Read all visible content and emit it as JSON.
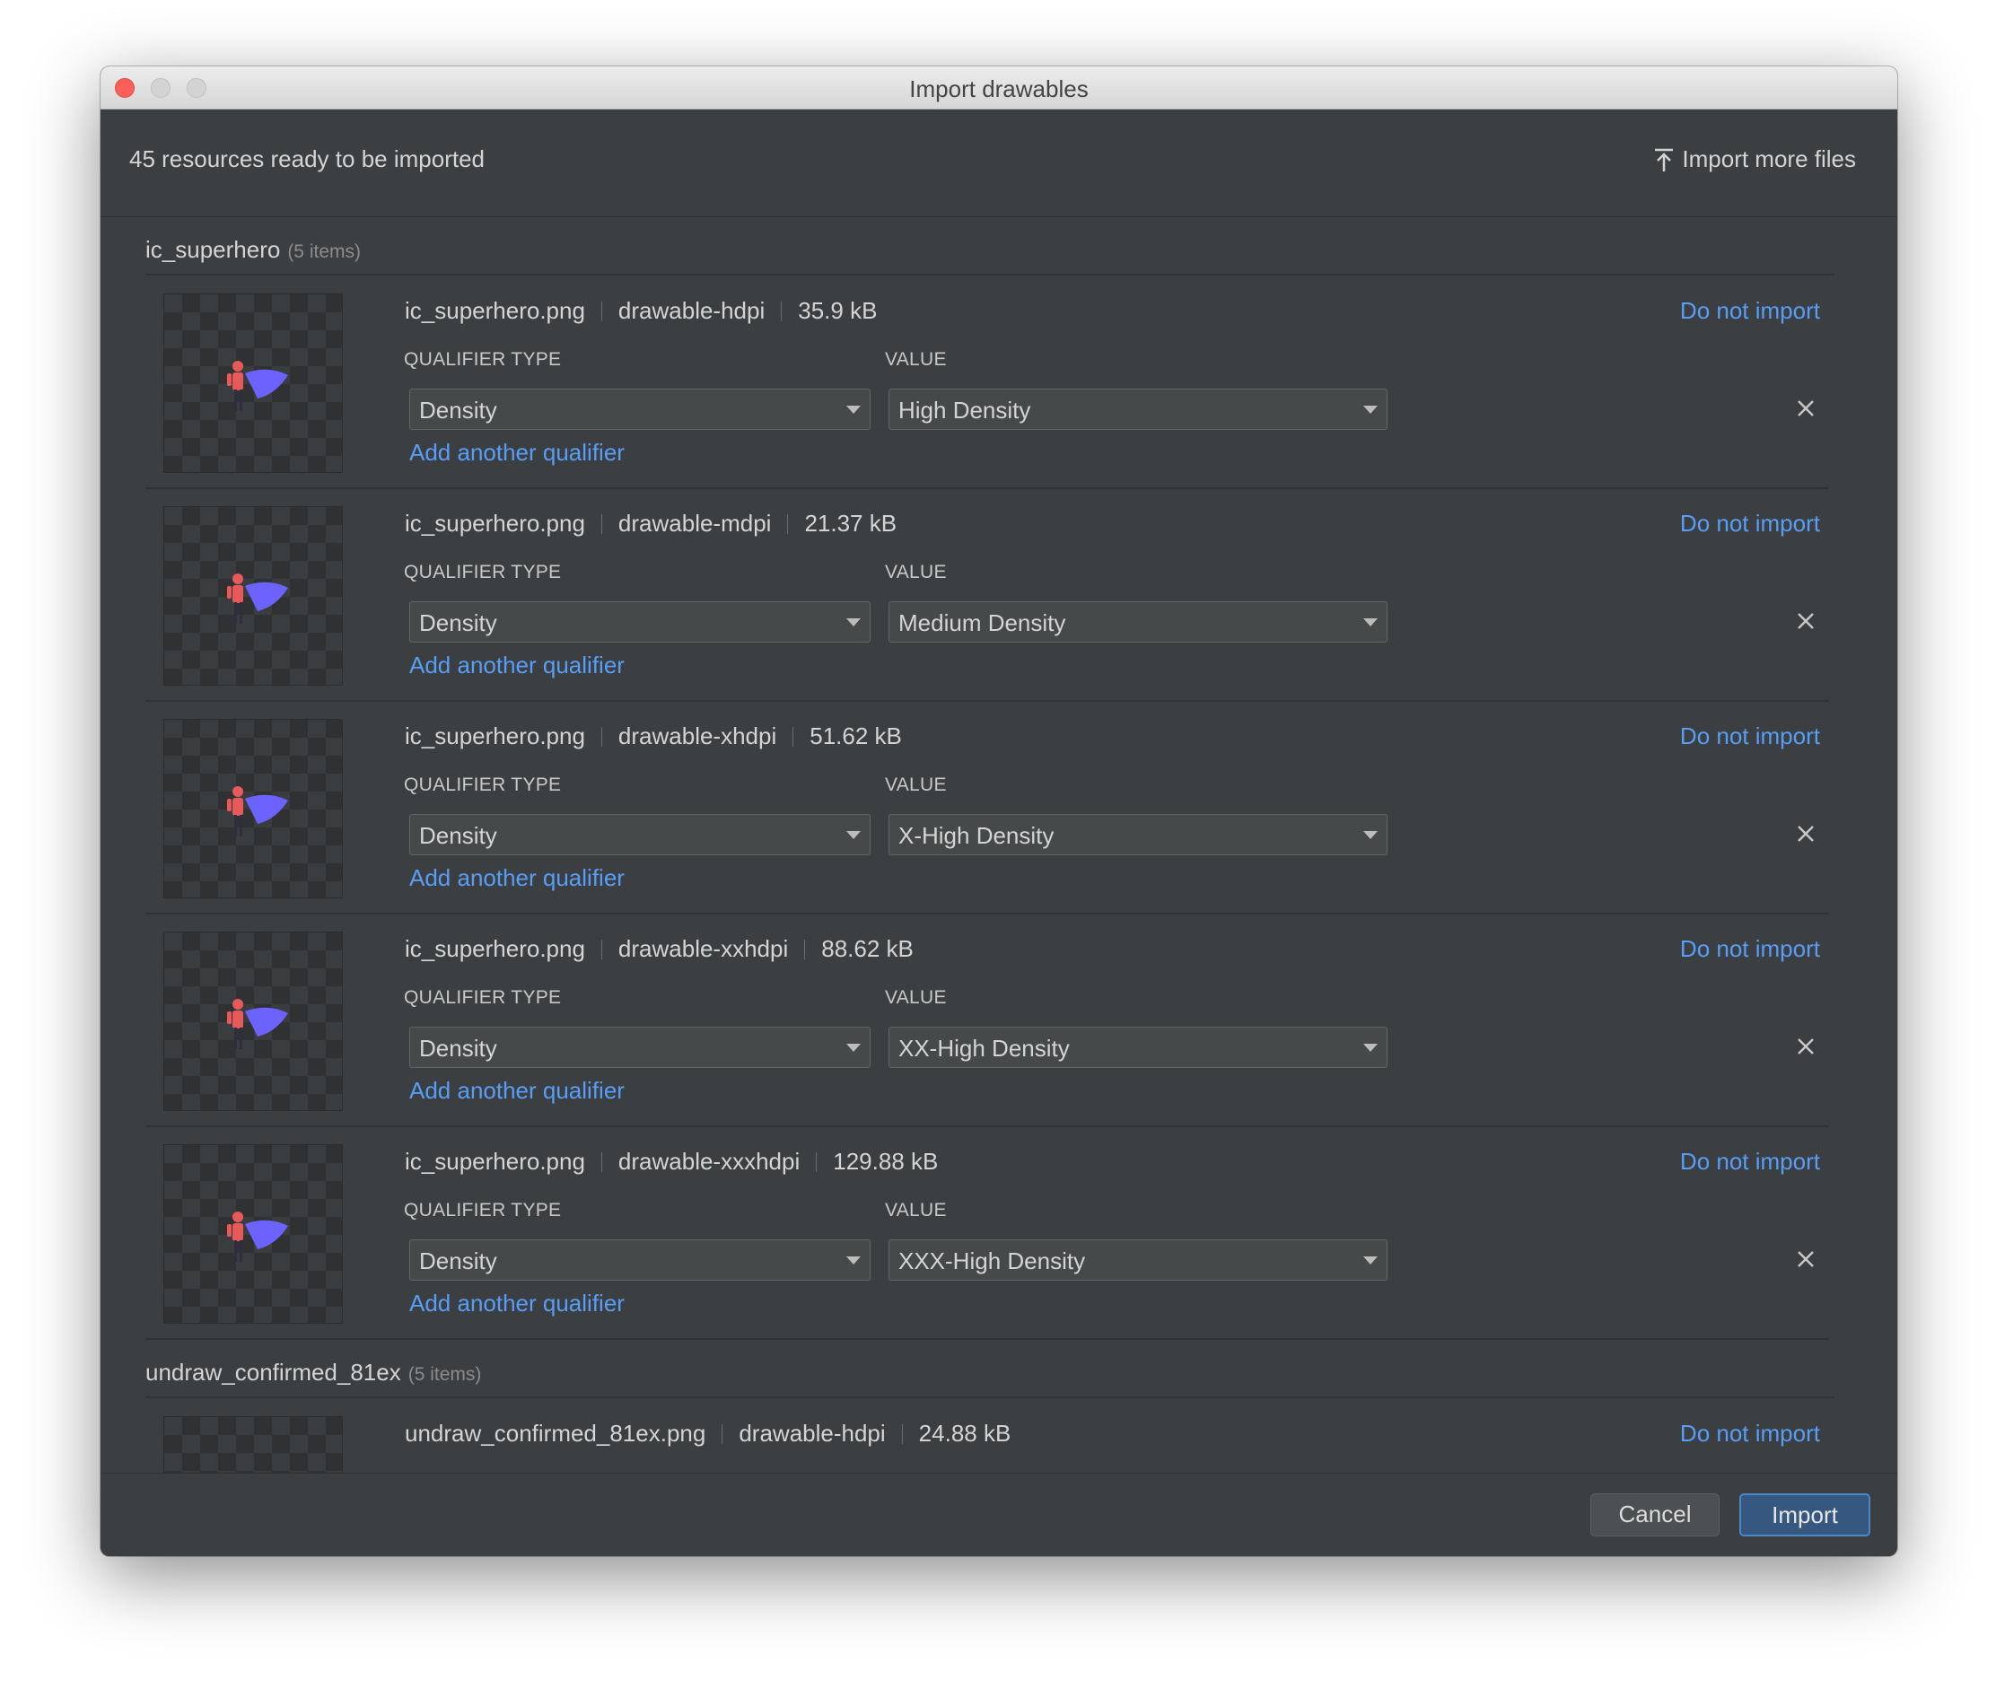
{
  "window": {
    "title": "Import drawables"
  },
  "topbar": {
    "ready_text": "45 resources ready to be imported",
    "import_more_label": "Import more files"
  },
  "labels": {
    "qualifier_type": "QUALIFIER TYPE",
    "value": "VALUE",
    "do_not_import": "Do not import",
    "add_qualifier": "Add another qualifier"
  },
  "groups": [
    {
      "name": "ic_superhero",
      "count": "(5 items)",
      "items": [
        {
          "file": "ic_superhero.png",
          "folder": "drawable-hdpi",
          "size": "35.9 kB",
          "qualifier_type": "Density",
          "value": "High Density"
        },
        {
          "file": "ic_superhero.png",
          "folder": "drawable-mdpi",
          "size": "21.37 kB",
          "qualifier_type": "Density",
          "value": "Medium Density"
        },
        {
          "file": "ic_superhero.png",
          "folder": "drawable-xhdpi",
          "size": "51.62 kB",
          "qualifier_type": "Density",
          "value": "X-High Density"
        },
        {
          "file": "ic_superhero.png",
          "folder": "drawable-xxhdpi",
          "size": "88.62 kB",
          "qualifier_type": "Density",
          "value": "XX-High Density"
        },
        {
          "file": "ic_superhero.png",
          "folder": "drawable-xxxhdpi",
          "size": "129.88 kB",
          "qualifier_type": "Density",
          "value": "XXX-High Density"
        }
      ]
    },
    {
      "name": "undraw_confirmed_81ex",
      "count": "(5 items)",
      "items": [
        {
          "file": "undraw_confirmed_81ex.png",
          "folder": "drawable-hdpi",
          "size": "24.88 kB"
        }
      ]
    }
  ],
  "footer": {
    "cancel_label": "Cancel",
    "import_label": "Import"
  },
  "colors": {
    "link": "#589df6",
    "background": "#3c3f41",
    "primary_button": "#365880"
  }
}
